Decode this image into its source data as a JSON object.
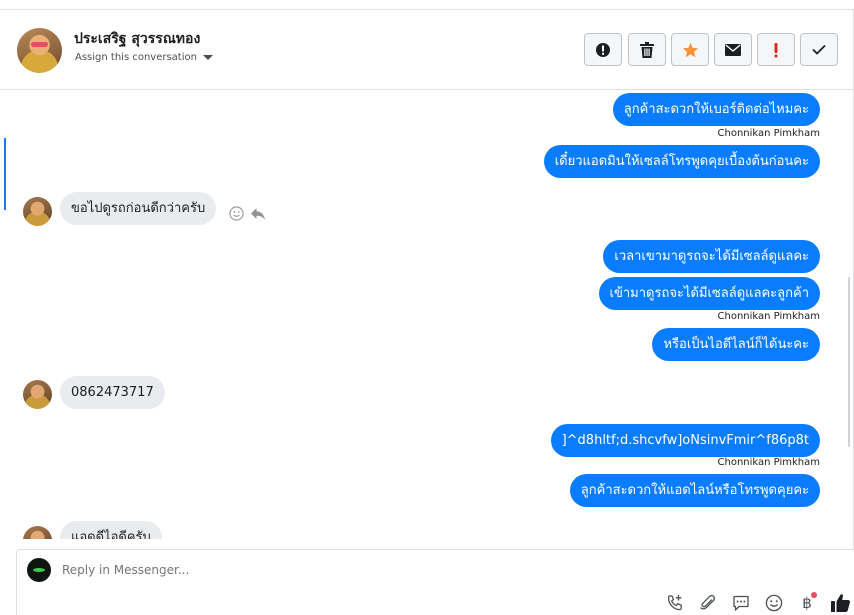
{
  "header": {
    "contact_name": "ประเสริฐ สุวรรณทอง",
    "assign_label": "Assign this conversation"
  },
  "toolbar": {
    "buttons": [
      {
        "icon": "alert-circle-icon"
      },
      {
        "icon": "trash-icon"
      },
      {
        "icon": "star-icon",
        "color": "#f7923a"
      },
      {
        "icon": "envelope-icon"
      },
      {
        "icon": "exclamation-icon",
        "color": "#e02a2a"
      },
      {
        "icon": "checkmark-icon"
      }
    ]
  },
  "messages": [
    {
      "direction": "out",
      "text": "ลูกค้าสะดวกให้เบอร์ติดต่อไหมคะ"
    },
    {
      "type": "sender",
      "text": "Chonnikan Pimkham"
    },
    {
      "direction": "out",
      "text": "เดี๋ยวแอดมินให้เซลล์โทรพูดคุยเบื้องต้นก่อนคะ"
    },
    {
      "direction": "in",
      "text": "ขอไปดูรถก่อนดีกว่าครับ"
    },
    {
      "direction": "out",
      "text": "เวลาเขามาดูรถจะได้มีเซลล์ดูแลคะ"
    },
    {
      "direction": "out",
      "text": "เข้ามาดูรถจะได้มีเซลล์ดูแลคะลูกค้า"
    },
    {
      "type": "sender",
      "text": "Chonnikan Pimkham"
    },
    {
      "direction": "out",
      "text": "หรือเป็นไอดีไลน์ก็ได้นะคะ"
    },
    {
      "direction": "in",
      "text": "0862473717"
    },
    {
      "direction": "out",
      "text": "]^d8hltf;d.shcvfw]oNsinvFmir^f86p8t"
    },
    {
      "type": "sender",
      "text": "Chonnikan Pimkham"
    },
    {
      "direction": "out",
      "text": "ลูกค้าสะดวกให้แอดไลน์หรือโทรพูดคุยคะ"
    },
    {
      "direction": "in",
      "text": "แอดดีไอดีครับ"
    }
  ],
  "composer": {
    "placeholder": "Reply in Messenger...",
    "icons": [
      "phone-add-icon",
      "paperclip-icon",
      "saved-replies-icon",
      "emoji-icon",
      "baht-payment-icon",
      "thumbs-up-icon"
    ],
    "baht_symbol": "฿",
    "accent": "#1877f2"
  }
}
